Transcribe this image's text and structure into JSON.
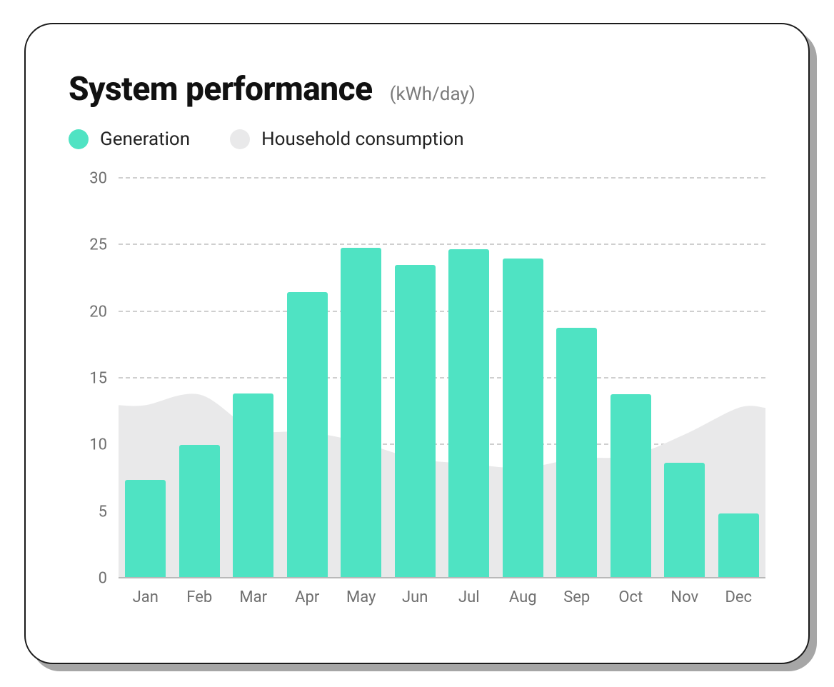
{
  "header": {
    "title": "System performance",
    "unit": "(kWh/day)"
  },
  "legend": {
    "generation": "Generation",
    "consumption": "Household consumption"
  },
  "colors": {
    "generation": "#4fe3c3",
    "consumption": "#e9e9ea",
    "text_muted": "#6f6f6f"
  },
  "chart_data": {
    "type": "bar",
    "title": "System performance",
    "ylabel": "kWh/day",
    "xlabel": "",
    "categories": [
      "Jan",
      "Feb",
      "Mar",
      "Apr",
      "May",
      "Jun",
      "Jul",
      "Aug",
      "Sep",
      "Oct",
      "Nov",
      "Dec"
    ],
    "series": [
      {
        "name": "Generation",
        "type": "bar",
        "values": [
          7.4,
          10.0,
          13.9,
          21.5,
          24.8,
          23.5,
          24.7,
          24.0,
          18.8,
          13.8,
          8.7,
          4.9
        ]
      },
      {
        "name": "Household consumption",
        "type": "area",
        "values": [
          13.0,
          13.8,
          11.2,
          11.0,
          10.2,
          9.0,
          8.6,
          8.3,
          9.0,
          9.2,
          10.8,
          12.8
        ]
      }
    ],
    "y_ticks": [
      0,
      5,
      10,
      15,
      20,
      25,
      30
    ],
    "ylim": [
      0,
      30
    ],
    "grid": true,
    "legend_position": "top-left"
  }
}
